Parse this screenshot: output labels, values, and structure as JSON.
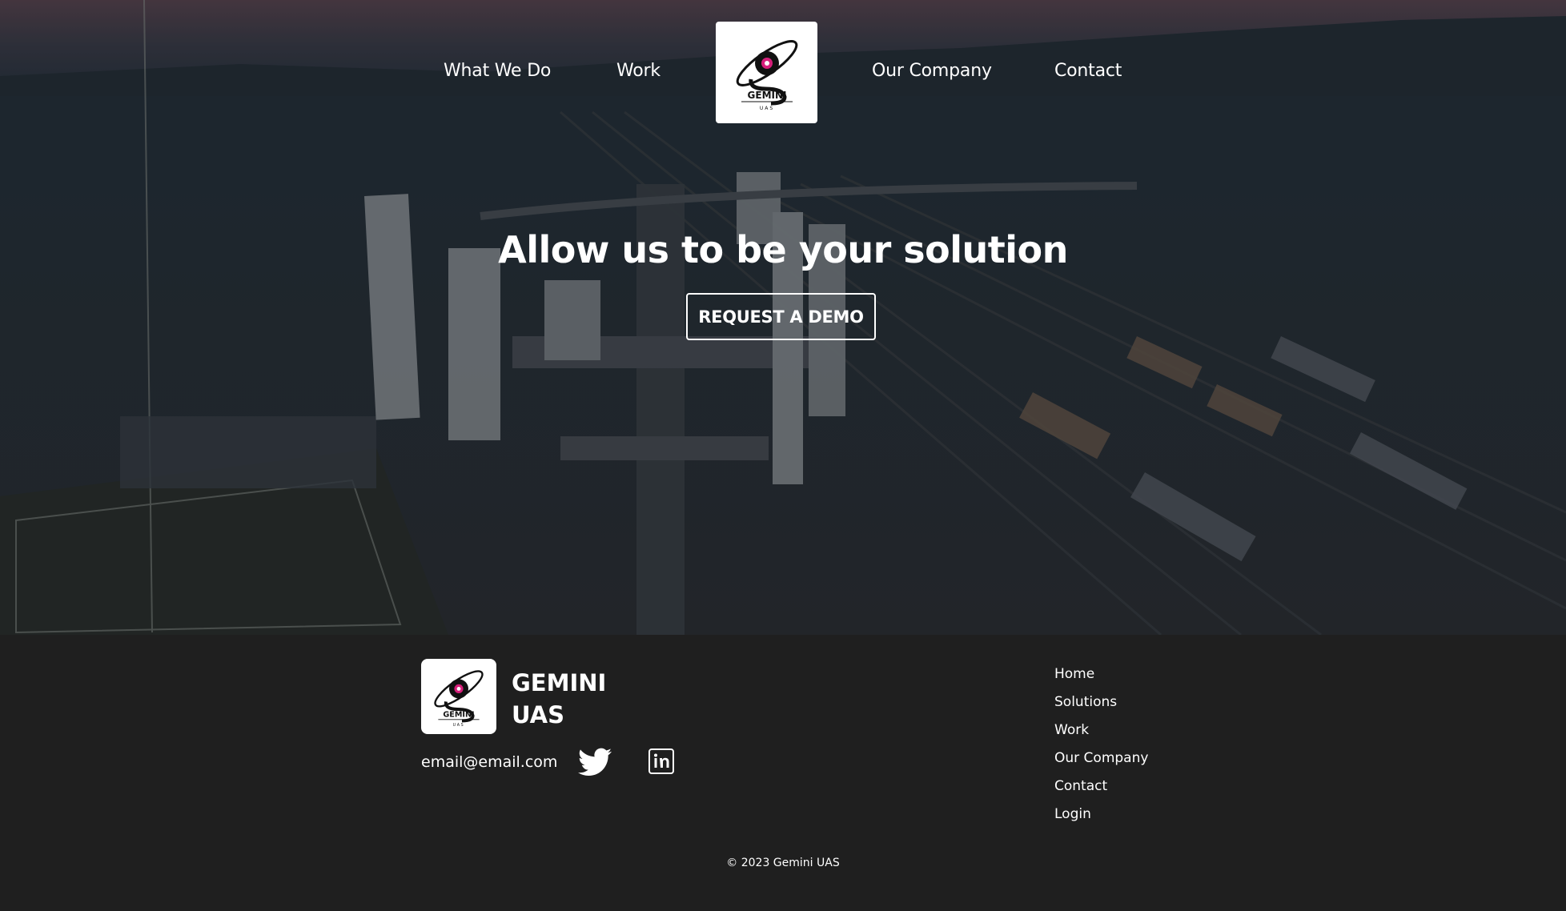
{
  "nav": {
    "links": [
      {
        "label": "What We Do"
      },
      {
        "label": "Work"
      },
      {
        "label": "Our Company"
      },
      {
        "label": "Contact"
      }
    ],
    "logo_text": "GEMINI",
    "logo_subtext": "UAS"
  },
  "hero": {
    "title": "Allow us to be your solution",
    "cta_label": "REQUEST A DEMO"
  },
  "footer": {
    "brand_line1": "GEMINI",
    "brand_line2": "UAS",
    "logo_text": "GEMINI",
    "logo_subtext": "UAS",
    "email": "email@email.com",
    "social": [
      {
        "icon": "twitter-icon"
      },
      {
        "icon": "linkedin-icon"
      }
    ],
    "links": [
      {
        "label": "Home"
      },
      {
        "label": "Solutions"
      },
      {
        "label": "Work"
      },
      {
        "label": "Our Company"
      },
      {
        "label": "Contact"
      },
      {
        "label": "Login"
      }
    ],
    "copyright": "© 2023 Gemini UAS"
  },
  "colors": {
    "footer_background": "#1f1f1f",
    "text": "#ffffff",
    "logo_accent": "#d61f7a"
  }
}
